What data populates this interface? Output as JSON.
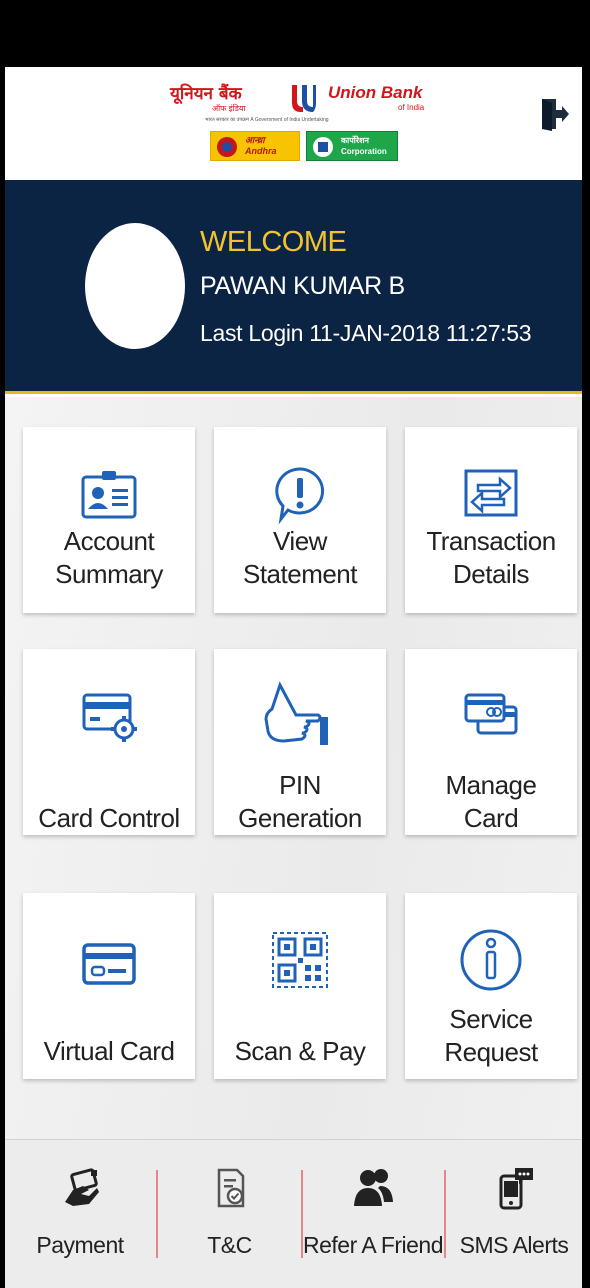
{
  "header": {
    "logo": {
      "hindi_name": "यूनियन बैंक",
      "hindi_sub": "ऑफ इंडिया",
      "english_name": "Union Bank",
      "english_sub": "of India",
      "tagline": "भारत सरकार का उपक्रम    A Government of India Undertaking",
      "andhra_hindi": "आन्ध्रा",
      "andhra_english": "Andhra",
      "corp_hindi": "कार्पोरेशन",
      "corp_english": "Corporation",
      "brand_red": "#d3151c"
    },
    "logout_icon": "logout-icon"
  },
  "welcome": {
    "title": "WELCOME",
    "name": "PAWAN KUMAR B",
    "last_login": "Last Login  11-JAN-2018 11:27:53",
    "accent": "#f2c32c",
    "background": "#0c2444"
  },
  "tiles": [
    {
      "label_line1": "Account",
      "label_line2": "Summary",
      "icon": "account-card-icon"
    },
    {
      "label_line1": "View",
      "label_line2": "Statement",
      "icon": "exclamation-bubble-icon"
    },
    {
      "label_line1": "Transaction",
      "label_line2": "Details",
      "icon": "transfer-arrows-icon"
    },
    {
      "label_line1": "",
      "label_line2": "Card Control",
      "icon": "card-gear-icon"
    },
    {
      "label_line1": "PIN",
      "label_line2": "Generation",
      "icon": "thumbs-up-icon"
    },
    {
      "label_line1": "Manage",
      "label_line2": "Card",
      "icon": "stacked-cards-icon"
    },
    {
      "label_line1": "",
      "label_line2": "Virtual Card",
      "icon": "virtual-card-icon"
    },
    {
      "label_line1": "",
      "label_line2": "Scan & Pay",
      "icon": "qr-code-icon"
    },
    {
      "label_line1": "Service",
      "label_line2": "Request",
      "icon": "info-circle-icon"
    }
  ],
  "bottom_nav": [
    {
      "label": "Payment",
      "icon": "payment-hand-icon"
    },
    {
      "label": "T&C",
      "icon": "document-check-icon"
    },
    {
      "label": "Refer A Friend",
      "icon": "people-icon"
    },
    {
      "label": "SMS Alerts",
      "icon": "sms-phone-icon"
    }
  ],
  "colors": {
    "icon_blue": "#1f62b8",
    "divider": "#e0898b"
  }
}
